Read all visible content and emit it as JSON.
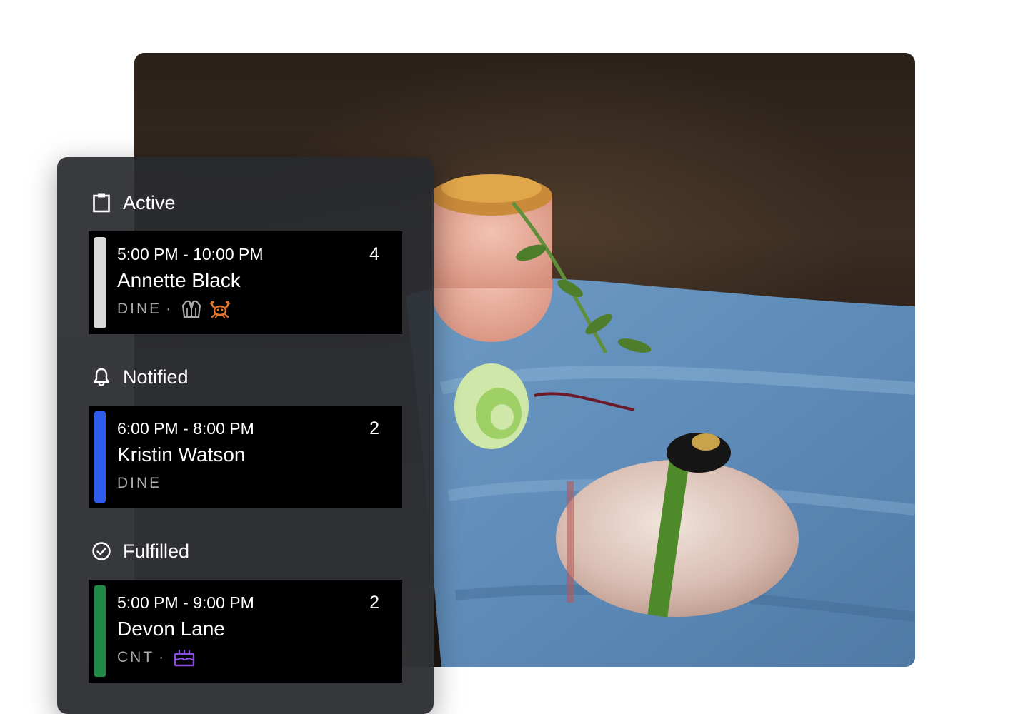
{
  "sections": [
    {
      "title": "Active",
      "icon": "clipboard-icon",
      "reservation": {
        "time": "5:00 PM - 10:00 PM",
        "count": "4",
        "name": "Annette Black",
        "type": "DINE",
        "status_color": "#d9d9d9",
        "tags": [
          "jacket-icon",
          "crab-icon"
        ]
      }
    },
    {
      "title": "Notified",
      "icon": "bell-icon",
      "reservation": {
        "time": "6:00 PM - 8:00 PM",
        "count": "2",
        "name": "Kristin Watson",
        "type": "DINE",
        "status_color": "#2f5bea",
        "tags": []
      }
    },
    {
      "title": "Fulfilled",
      "icon": "check-circle-icon",
      "reservation": {
        "time": "5:00 PM - 9:00 PM",
        "count": "2",
        "name": "Devon Lane",
        "type": "CNT",
        "status_color": "#1e8a45",
        "tags": [
          "cake-icon"
        ]
      }
    }
  ],
  "colors": {
    "crab_icon": "#e8762b",
    "cake_icon": "#8a4fe0",
    "jacket_icon": "#a9a9ad"
  }
}
